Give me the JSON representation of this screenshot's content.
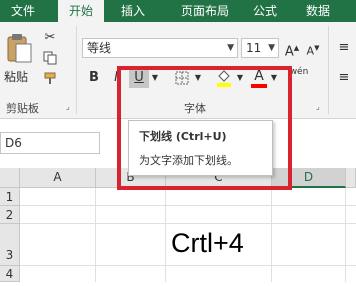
{
  "tabs": [
    "文件",
    "开始",
    "插入",
    "页面布局",
    "公式",
    "数据"
  ],
  "active_tab": "开始",
  "ribbon": {
    "clipboard": {
      "paste_label": "粘贴",
      "group_label": "剪贴板"
    },
    "font": {
      "name": "等线",
      "size": "11",
      "group_label": "字体",
      "grow_label": "A",
      "shrink_label": "A",
      "bold": "B",
      "italic": "I",
      "underline": "U",
      "font_color_label": "A",
      "phonetic_label": "wén",
      "fill_color": "#ffff00",
      "font_color": "#ff0000"
    }
  },
  "tooltip": {
    "title": "下划线 (Ctrl+U)",
    "description": "为文字添加下划线。"
  },
  "formula_bar": {
    "name_box": "D6"
  },
  "sheet": {
    "columns": [
      "A",
      "B",
      "C",
      "D"
    ],
    "selected_column": "D",
    "rows": [
      "1",
      "2",
      "3",
      "4"
    ],
    "cell_c3": "Crtl+4"
  },
  "colors": {
    "accent": "#217346",
    "highlight": "#d9232e"
  }
}
